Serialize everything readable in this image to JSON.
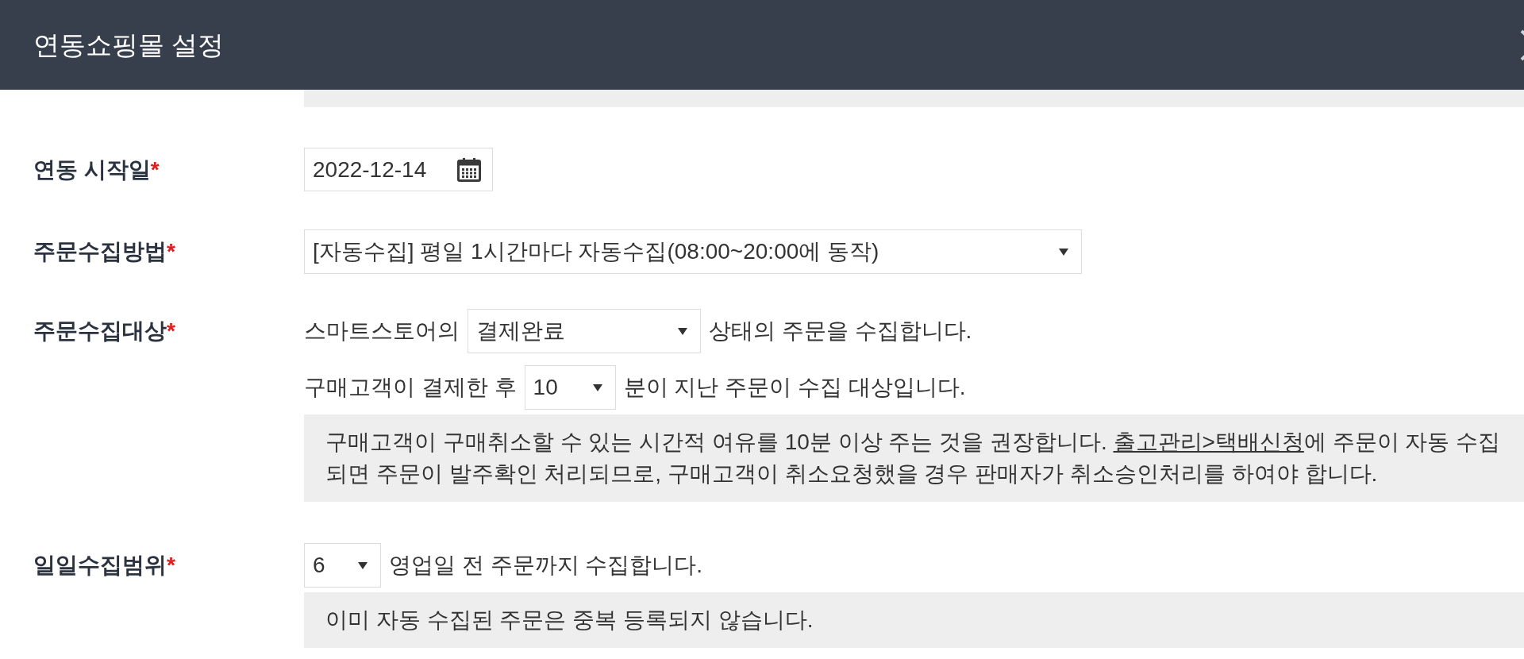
{
  "window": {
    "title": "연동쇼핑몰 설정"
  },
  "fields": [
    {
      "kind": "date",
      "label": "연동 시작일",
      "required_mark": "*",
      "value": "2022-12-14"
    },
    {
      "kind": "select",
      "label": "주문수집방법",
      "required_mark": "*",
      "value": "[자동수집] 평일 1시간마다 자동수집(08:00~20:00에 동작)"
    },
    {
      "kind": "sentences",
      "label": "주문수집대상",
      "required_mark": "*",
      "lines": [
        {
          "before": "스마트스토어의",
          "value": "결제완료",
          "after": "상태의 주문을 수집합니다."
        },
        {
          "before": "구매고객이 결제한 후",
          "value": "10",
          "after": "분이 지난 주문이 수집 대상입니다."
        }
      ],
      "note": {
        "parts": [
          {
            "kind": "text",
            "text": "구매고객이 구매취소할 수 있는 시간적 여유를 10분 이상 주는 것을 권장합니다. "
          },
          {
            "kind": "link",
            "text": "출고관리>택배신청"
          },
          {
            "kind": "text",
            "text": "에 주문이 자동 수집되면 주문이 발주확인 처리되므로, 구매고객이 취소요청했을 경우 판매자가 취소승인처리를 하여야 합니다."
          }
        ]
      }
    },
    {
      "kind": "sentences",
      "label": "일일수집범위",
      "required_mark": "*",
      "lines": [
        {
          "value": "6",
          "after": "영업일 전 주문까지 수집합니다."
        }
      ],
      "note": {
        "parts": [
          {
            "kind": "text",
            "text": "이미 자동 수집된 주문은 중복 등록되지 않습니다."
          }
        ]
      }
    }
  ]
}
